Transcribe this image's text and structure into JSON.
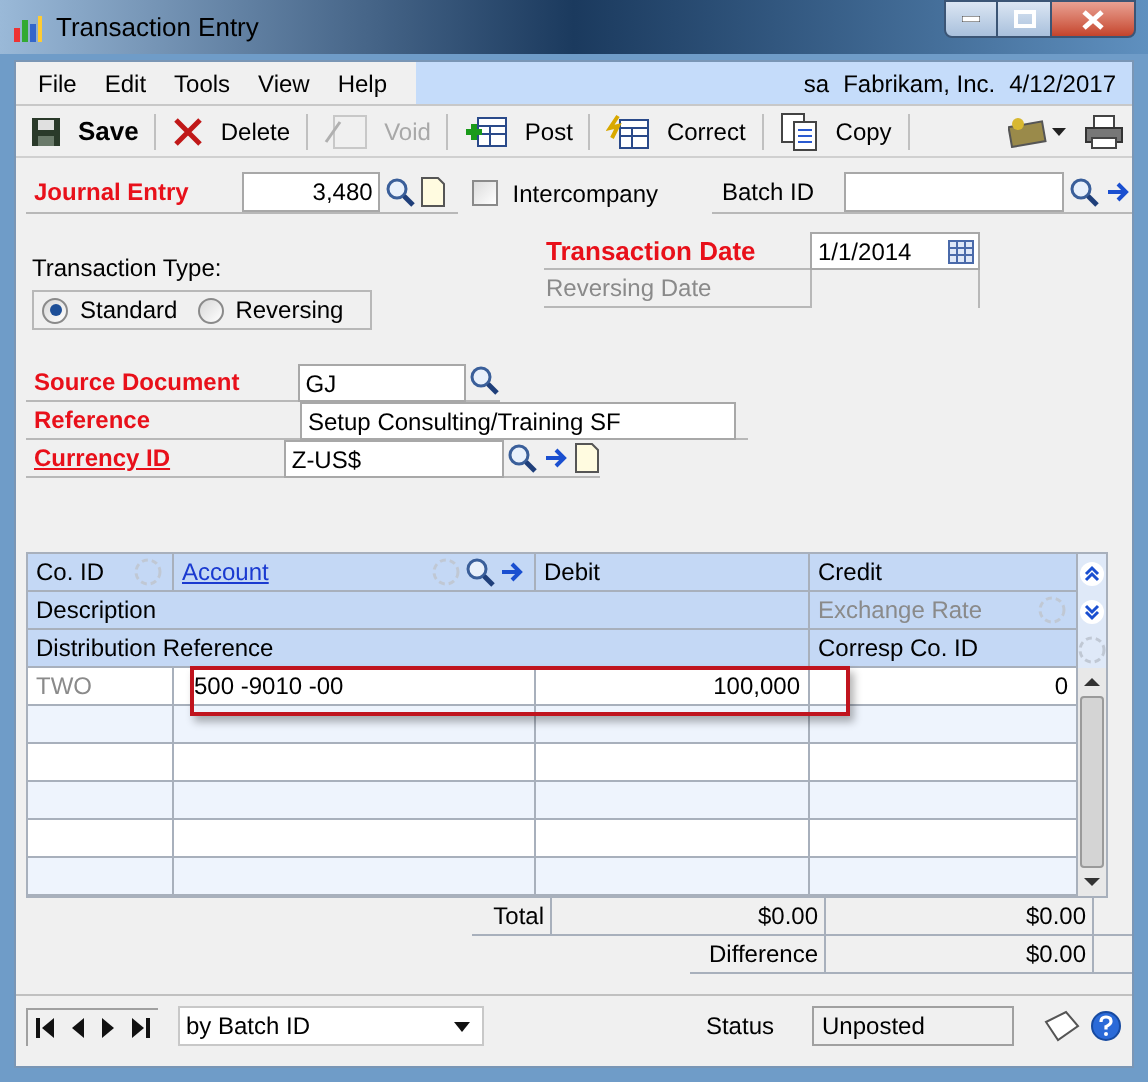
{
  "window": {
    "title": "Transaction Entry"
  },
  "menu": [
    "File",
    "Edit",
    "Tools",
    "View",
    "Help"
  ],
  "session": {
    "user": "sa",
    "company": "Fabrikam, Inc.",
    "date": "4/12/2017"
  },
  "toolbar": [
    {
      "label": "Save",
      "kind": "save",
      "disabled": false
    },
    {
      "label": "Delete",
      "kind": "delete",
      "disabled": false
    },
    {
      "label": "Void",
      "kind": "void",
      "disabled": true
    },
    {
      "label": "Post",
      "kind": "post",
      "disabled": false
    },
    {
      "label": "Correct",
      "kind": "correct",
      "disabled": false
    },
    {
      "label": "Copy",
      "kind": "copy",
      "disabled": false
    }
  ],
  "journal_entry": {
    "label": "Journal Entry",
    "value": "3,480"
  },
  "intercompany": {
    "label": "Intercompany",
    "checked": false
  },
  "batch_id": {
    "label": "Batch ID"
  },
  "transaction_type": {
    "label": "Transaction Type:",
    "options": [
      {
        "label": "Standard",
        "selected": true
      },
      {
        "label": "Reversing",
        "selected": false
      }
    ]
  },
  "transaction_date": {
    "label": "Transaction Date",
    "value": "1/1/2014"
  },
  "reversing_date": {
    "label": "Reversing Date"
  },
  "source_document": {
    "label": "Source Document",
    "value": "GJ"
  },
  "reference": {
    "label": "Reference",
    "value": "Setup Consulting/Training SF"
  },
  "currency_id": {
    "label": "Currency ID",
    "value": "Z-US$"
  },
  "grid": {
    "header_row_1": [
      "Co. ID",
      "Account",
      "Debit",
      "Credit"
    ],
    "header_row_2": [
      "Description",
      "Exchange Rate"
    ],
    "header_row_3": [
      "Distribution Reference",
      "Corresp Co. ID"
    ],
    "rows": [
      {
        "co_id": "TWO",
        "account": "500 -9010 -00",
        "debit": "100,000",
        "credit": "0",
        "highlighted": true
      }
    ]
  },
  "totals": {
    "total_label": "Total",
    "total_debit": "$0.00",
    "total_credit": "$0.00",
    "difference_label": "Difference",
    "difference": "$0.00"
  },
  "footer": {
    "sort": "by Batch ID",
    "status_label": "Status",
    "status": "Unposted"
  }
}
